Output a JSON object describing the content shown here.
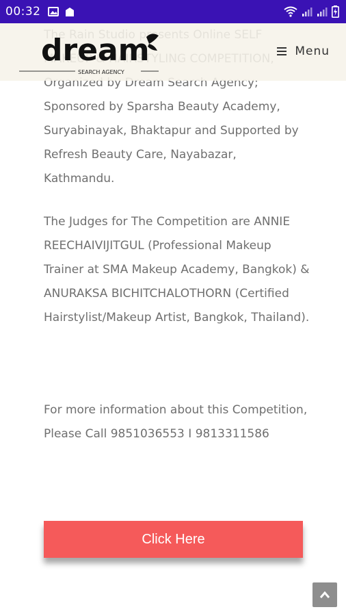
{
  "status_bar": {
    "time": "00:32",
    "icons": [
      "image-icon",
      "notification-icon",
      "wifi-icon",
      "signal-icon",
      "signal-icon",
      "battery-charging-icon"
    ]
  },
  "header": {
    "logo_text": "dream",
    "logo_subtitle": "SEARCH AGENCY",
    "menu_label": "Menu",
    "menu_icon": "hamburger-icon"
  },
  "article": {
    "paragraphs": [
      "The Rain Studio presents Online SELF MAKEUP & HAIRSTYLING COMPETITION, Organized by Dream Search Agency; Sponsored by Sparsha Beauty Academy, Suryabinayak, Bhaktapur and Supported by Refresh Beauty Care, Nayabazar, Kathmandu.",
      "The Judges for The Competition are ANNIE REECHAIVIJITGUL (Professional Makeup Trainer at SMA Makeup Academy, Bangkok) & ANURAKSA BICHITCHALOTHORN (Certified Hairstylist/Makeup Artist, Bangkok, Thailand).",
      "For more information about this Competition, Please Call 9851036553 I 9813311586"
    ]
  },
  "cta": {
    "label": "Click Here"
  },
  "scroll_top": {
    "icon": "chevron-up-icon"
  },
  "colors": {
    "status_bar": "#3a12b4",
    "button": "#f55a5a",
    "body_text": "#6f6f6f",
    "header_bg": "#f6f3e9"
  }
}
